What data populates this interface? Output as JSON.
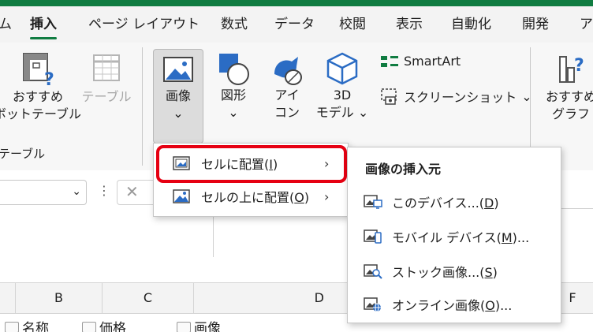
{
  "tabs": [
    "ム",
    "挿入",
    "ページ レイアウト",
    "数式",
    "データ",
    "校閲",
    "表示",
    "自動化",
    "開発",
    "ア"
  ],
  "ribbon": {
    "recommended_pivot": [
      "おすすめ",
      "ボットテーブル"
    ],
    "table": "テーブル",
    "group_table_label": "テーブル",
    "image": "画像",
    "shapes": "図形",
    "icons": [
      "アイ",
      "コン"
    ],
    "model3d": [
      "3D",
      "モデル"
    ],
    "smartart": "SmartArt",
    "screenshot": "スクリーンショット",
    "recommended_graph": [
      "おすすめ",
      "グラフ"
    ]
  },
  "image_menu": {
    "items": [
      {
        "label": "セルに配置(",
        "key": "I",
        "tail": ")"
      },
      {
        "label": "セルの上に配置(",
        "key": "O",
        "tail": ")"
      }
    ]
  },
  "insert_from_menu": {
    "header": "画像の挿入元",
    "items": [
      {
        "label": "このデバイス...(",
        "key": "D",
        "tail": ")"
      },
      {
        "label": "モバイル デバイス(",
        "key": "M",
        "tail": ")..."
      },
      {
        "label": "ストック画像...(",
        "key": "S",
        "tail": ")"
      },
      {
        "label": "オンライン画像(",
        "key": "O",
        "tail": ")..."
      }
    ]
  },
  "columns": [
    "B",
    "C",
    "D",
    "F"
  ],
  "row1": [
    "名称",
    "価格",
    "画像"
  ],
  "colors": {
    "accent": "#107c41",
    "highlight": "#e60012",
    "icon_blue": "#2b6cc4"
  }
}
